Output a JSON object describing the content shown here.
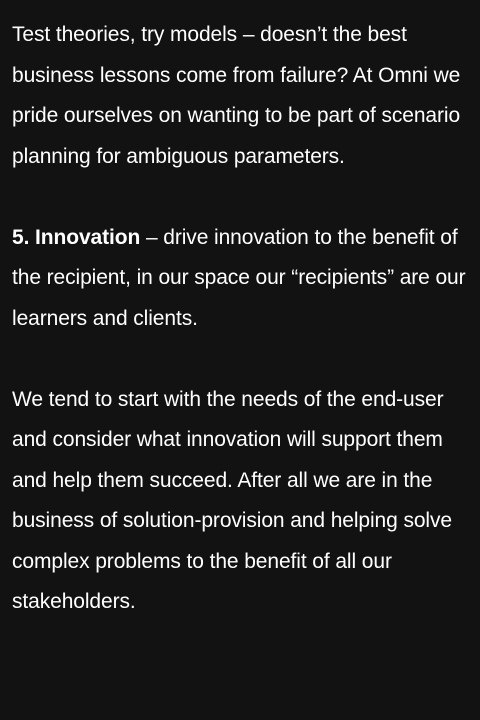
{
  "article": {
    "paragraph_1": "Test theories, try models – doesn’t the best business lessons come from failure? At Omni we pride ourselves on wanting to be part of scenario planning for ambiguous parameters.",
    "section_heading": "5. Innovation",
    "paragraph_2_rest": " – drive innovation to the benefit of the recipient, in our space our “recipients” are our learners and clients.",
    "paragraph_3": "We tend to start with the needs of the end-user and consider what innovation will support them and help them succeed. After all we are in the business of solution-provision and helping solve complex problems to the benefit of all our stakeholders."
  },
  "colors": {
    "background": "#121212",
    "text": "#ffffff"
  }
}
